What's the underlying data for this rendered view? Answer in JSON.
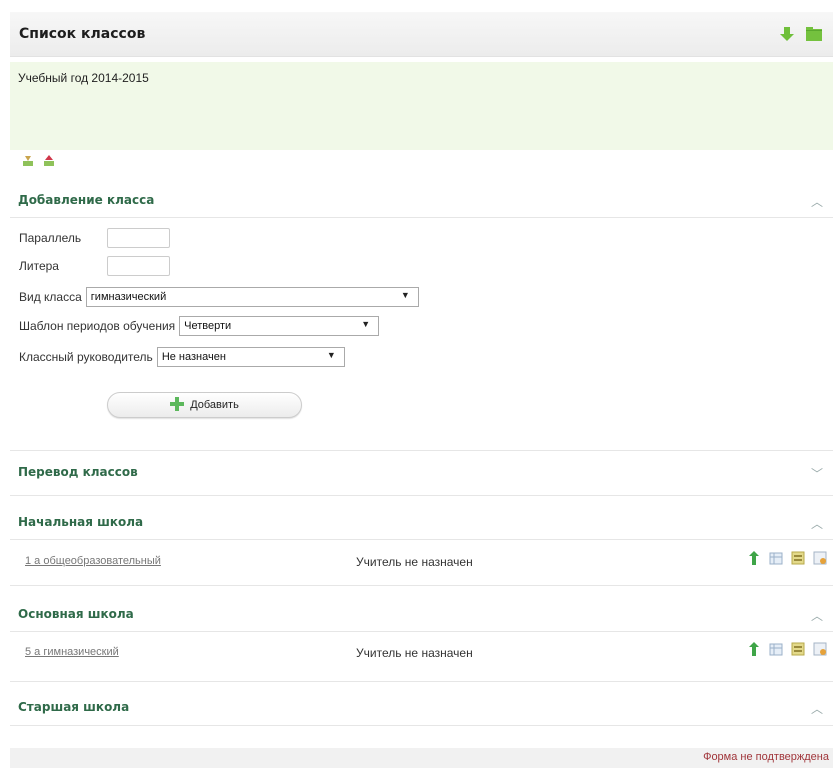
{
  "header": {
    "title": "Список классов",
    "icons": [
      "download-icon",
      "excel-icon"
    ]
  },
  "year_label": "Учебный год 2014-2015",
  "mini_icons": [
    "import-icon",
    "export-icon"
  ],
  "add_section": {
    "title": "Добавление класса",
    "parallel_label": "Параллель",
    "parallel_value": "",
    "litera_label": "Литера",
    "litera_value": "",
    "type_label": "Вид класса",
    "type_value": "гимназический",
    "periods_label": "Шаблон периодов обучения",
    "periods_value": "Четверти",
    "teacher_label": "Классный руководитель",
    "teacher_value": "Не назначен",
    "add_button": "Добавить"
  },
  "sections": {
    "transfer": "Перевод классов",
    "primary": "Начальная школа",
    "basic": "Основная школа",
    "senior": "Старшая школа"
  },
  "rows": {
    "primary": [
      {
        "class": "1 а общеобразовательный",
        "teacher": "Учитель не назначен"
      }
    ],
    "basic": [
      {
        "class": "5 а гимназический",
        "teacher": "Учитель не назначен"
      }
    ]
  },
  "footer_status": "Форма не подтверждена",
  "colors": {
    "section_heading": "#2f6a49",
    "year_bg": "#f1f9e8",
    "status_text": "#a0353a"
  }
}
